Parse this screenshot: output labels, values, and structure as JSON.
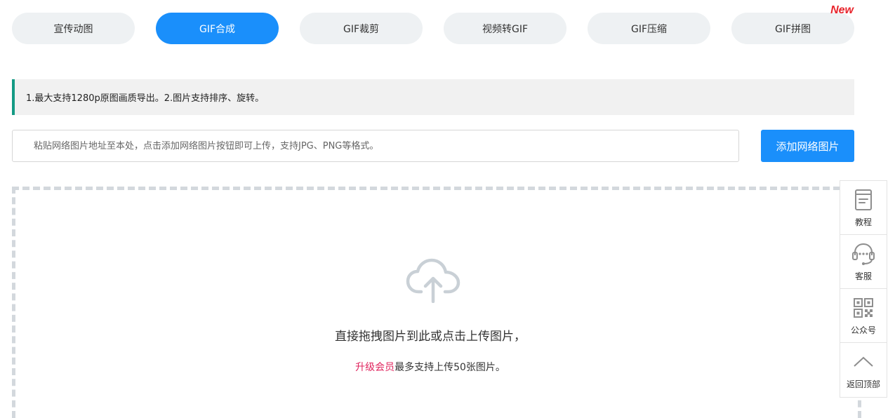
{
  "tabs": [
    {
      "label": "宣传动图",
      "active": false
    },
    {
      "label": "GIF合成",
      "active": true
    },
    {
      "label": "GIF裁剪",
      "active": false
    },
    {
      "label": "视频转GIF",
      "active": false
    },
    {
      "label": "GIF压缩",
      "active": false
    },
    {
      "label": "GIF拼图",
      "active": false,
      "badge": "New"
    }
  ],
  "notice": {
    "text": "1.最大支持1280p原图画质导出。2.图片支持排序、旋转。"
  },
  "url_input": {
    "value": "",
    "placeholder": "粘贴网络图片地址至本处，点击添加网络图片按钮即可上传，支持JPG、PNG等格式。"
  },
  "add_button": {
    "label": "添加网络图片"
  },
  "dropzone": {
    "icon": "cloud-upload-icon",
    "main_text": "直接拖拽图片到此或点击上传图片，",
    "upgrade_link": "升级会员",
    "sub_text": "最多支持上传50张图片。"
  },
  "sidebar": {
    "items": [
      {
        "label": "教程",
        "icon": "document-icon"
      },
      {
        "label": "客服",
        "icon": "headset-icon"
      },
      {
        "label": "公众号",
        "icon": "qrcode-icon"
      },
      {
        "label": "返回顶部",
        "icon": "chevron-up-icon"
      }
    ]
  },
  "colors": {
    "accent": "#1a8ffb",
    "tab_bg": "#eef1f3",
    "notice_border": "#149a84",
    "new_badge": "#e8242c",
    "upgrade_link": "#e0245e"
  }
}
